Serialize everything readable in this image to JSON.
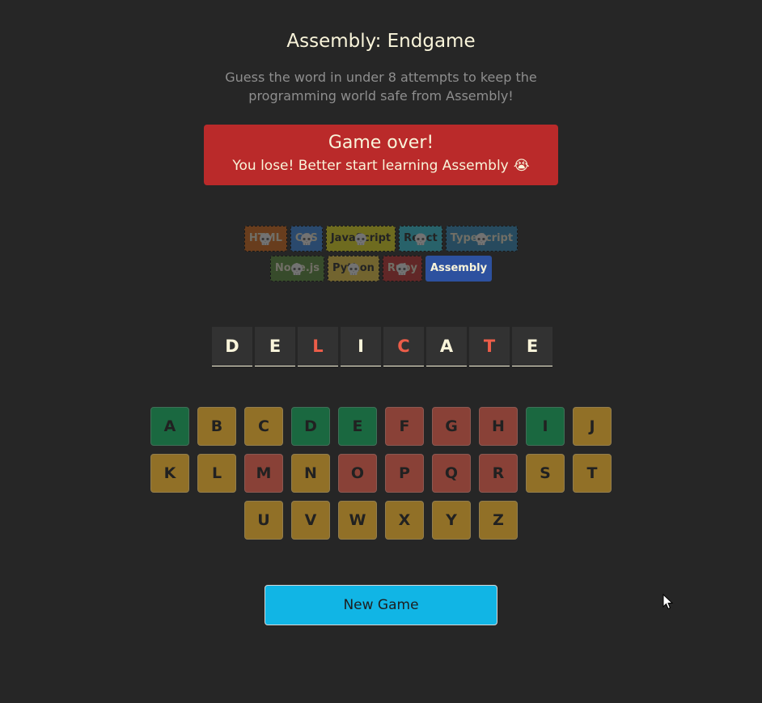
{
  "header": {
    "title": "Assembly: Endgame",
    "subtitle": "Guess the word in under 8 attempts to keep the programming world safe from Assembly!"
  },
  "status": {
    "title": "Game over!",
    "message": "You lose! Better start learning Assembly",
    "emoji": "😭",
    "color": "#BA2A2A"
  },
  "languages": [
    {
      "name": "HTML",
      "bg": "#E2680F",
      "fg": "#F9F4DA",
      "lost": true
    },
    {
      "name": "CSS",
      "bg": "#328AF1",
      "fg": "#F9F4DA",
      "lost": true
    },
    {
      "name": "JavaScript",
      "bg": "#F4EB13",
      "fg": "#1E1E1E",
      "lost": true
    },
    {
      "name": "React",
      "bg": "#2ED3E9",
      "fg": "#1E1E1E",
      "lost": true
    },
    {
      "name": "TypeScript",
      "bg": "#298EC6",
      "fg": "#F9F4DA",
      "lost": true
    },
    {
      "name": "Node.js",
      "bg": "#599137",
      "fg": "#F9F4DA",
      "lost": true
    },
    {
      "name": "Python",
      "bg": "#FFD742",
      "fg": "#1E1E1E",
      "lost": true
    },
    {
      "name": "Ruby",
      "bg": "#D02B2B",
      "fg": "#F9F4DA",
      "lost": true
    },
    {
      "name": "Assembly",
      "bg": "#2D519F",
      "fg": "#F9F4DA",
      "lost": false
    }
  ],
  "word": [
    {
      "letter": "D",
      "missed": false
    },
    {
      "letter": "E",
      "missed": false
    },
    {
      "letter": "L",
      "missed": true
    },
    {
      "letter": "I",
      "missed": false
    },
    {
      "letter": "C",
      "missed": true
    },
    {
      "letter": "A",
      "missed": false
    },
    {
      "letter": "T",
      "missed": true
    },
    {
      "letter": "E",
      "missed": false
    }
  ],
  "keyboard": [
    [
      {
        "key": "A",
        "state": "correct"
      },
      {
        "key": "B",
        "state": "unused"
      },
      {
        "key": "C",
        "state": "unused"
      },
      {
        "key": "D",
        "state": "correct"
      },
      {
        "key": "E",
        "state": "correct"
      },
      {
        "key": "F",
        "state": "wrong"
      },
      {
        "key": "G",
        "state": "wrong"
      },
      {
        "key": "H",
        "state": "wrong"
      },
      {
        "key": "I",
        "state": "correct"
      },
      {
        "key": "J",
        "state": "unused"
      }
    ],
    [
      {
        "key": "K",
        "state": "unused"
      },
      {
        "key": "L",
        "state": "unused"
      },
      {
        "key": "M",
        "state": "wrong"
      },
      {
        "key": "N",
        "state": "unused"
      },
      {
        "key": "O",
        "state": "wrong"
      },
      {
        "key": "P",
        "state": "wrong"
      },
      {
        "key": "Q",
        "state": "wrong"
      },
      {
        "key": "R",
        "state": "wrong"
      },
      {
        "key": "S",
        "state": "unused"
      },
      {
        "key": "T",
        "state": "unused"
      }
    ],
    [
      {
        "key": "U",
        "state": "unused"
      },
      {
        "key": "V",
        "state": "unused"
      },
      {
        "key": "W",
        "state": "unused"
      },
      {
        "key": "X",
        "state": "unused"
      },
      {
        "key": "Y",
        "state": "unused"
      },
      {
        "key": "Z",
        "state": "unused"
      }
    ]
  ],
  "new_game_label": "New Game"
}
